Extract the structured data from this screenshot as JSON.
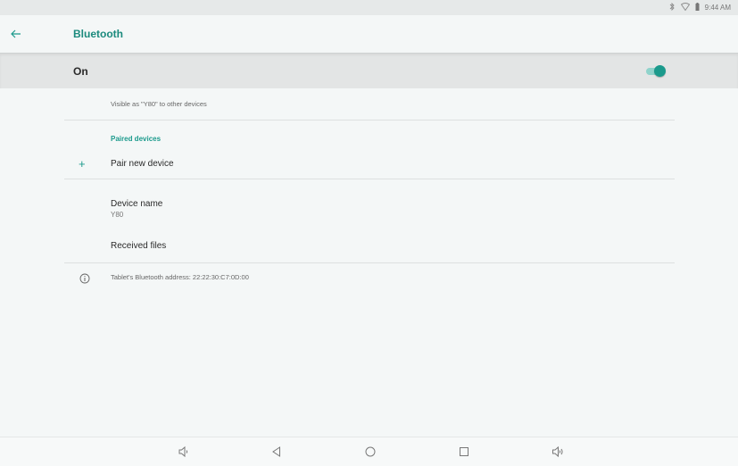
{
  "status_bar": {
    "time": "9:44 AM",
    "icons": [
      "bluetooth-icon",
      "wifi-icon",
      "battery-icon"
    ]
  },
  "app_bar": {
    "title": "Bluetooth",
    "back_icon": "arrow-left-icon"
  },
  "main_switch": {
    "label": "On",
    "checked": true
  },
  "visibility_text": "Visible as \"Y80\" to other devices",
  "paired_devices": {
    "header": "Paired devices",
    "pair_new_label": "Pair new device"
  },
  "device_name": {
    "title": "Device name",
    "value": "Y80"
  },
  "received_files_label": "Received files",
  "address_text": "Tablet's Bluetooth address: 22:22:30:C7:0D:00",
  "colors": {
    "accent": "#1b9a8c",
    "title": "#1b8a7d",
    "background": "#f4f7f7",
    "switch_bar": "#e3e5e5"
  },
  "nav_bar": {
    "buttons": [
      "volume-down-icon",
      "back-triangle-icon",
      "home-circle-icon",
      "recents-square-icon",
      "volume-up-icon"
    ]
  }
}
